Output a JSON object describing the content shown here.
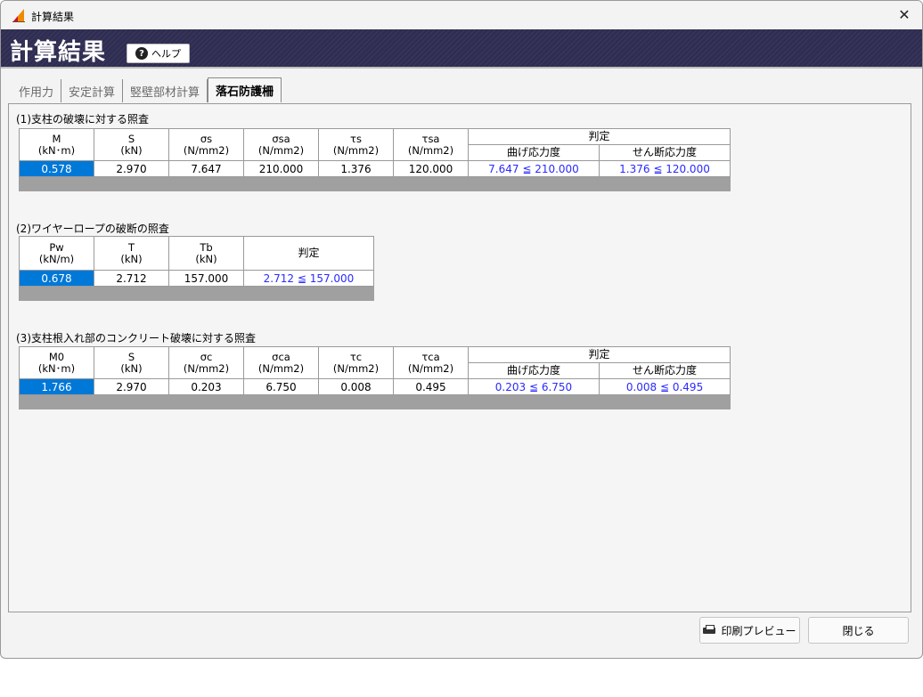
{
  "window": {
    "title": "計算結果",
    "close_label": "✕"
  },
  "banner": {
    "title": "計算結果",
    "help_label": "ヘルプ"
  },
  "tabs": [
    {
      "label": "作用力"
    },
    {
      "label": "安定計算"
    },
    {
      "label": "竪壁部材計算"
    },
    {
      "label": "落石防護柵",
      "active": true
    }
  ],
  "section1": {
    "title": "(1)支柱の破壊に対する照査",
    "headers": [
      {
        "top": "M",
        "unit": "(kN･m)"
      },
      {
        "top": "S",
        "unit": "(kN)"
      },
      {
        "top": "σs",
        "unit": "(N/mm2)"
      },
      {
        "top": "σsa",
        "unit": "(N/mm2)"
      },
      {
        "top": "τs",
        "unit": "(N/mm2)"
      },
      {
        "top": "τsa",
        "unit": "(N/mm2)"
      }
    ],
    "judge_label": "判定",
    "judge_sub": [
      "曲げ応力度",
      "せん断応力度"
    ],
    "row": [
      "0.578",
      "2.970",
      "7.647",
      "210.000",
      "1.376",
      "120.000",
      "7.647 ≦ 210.000",
      "1.376 ≦ 120.000"
    ]
  },
  "section2": {
    "title": "(2)ワイヤーロープの破断の照査",
    "headers": [
      {
        "top": "Pw",
        "unit": "(kN/m)"
      },
      {
        "top": "T",
        "unit": "(kN)"
      },
      {
        "top": "Tb",
        "unit": "(kN)"
      }
    ],
    "judge_label": "判定",
    "row": [
      "0.678",
      "2.712",
      "157.000",
      "2.712 ≦ 157.000"
    ]
  },
  "section3": {
    "title": "(3)支柱根入れ部のコンクリート破壊に対する照査",
    "headers": [
      {
        "top": "M0",
        "unit": "(kN･m)"
      },
      {
        "top": "S",
        "unit": "(kN)"
      },
      {
        "top": "σc",
        "unit": "(N/mm2)"
      },
      {
        "top": "σca",
        "unit": "(N/mm2)"
      },
      {
        "top": "τc",
        "unit": "(N/mm2)"
      },
      {
        "top": "τca",
        "unit": "(N/mm2)"
      }
    ],
    "judge_label": "判定",
    "judge_sub": [
      "曲げ応力度",
      "せん断応力度"
    ],
    "row": [
      "1.766",
      "2.970",
      "0.203",
      "6.750",
      "0.008",
      "0.495",
      "0.203 ≦ 6.750",
      "0.008 ≦ 0.495"
    ]
  },
  "buttons": {
    "print_preview": "印刷プレビュー",
    "close": "閉じる"
  },
  "colors": {
    "banner": "#2f2d52",
    "selection": "#0078d7",
    "judge_text": "#2a2aff",
    "footer_row": "#a0a0a0"
  }
}
